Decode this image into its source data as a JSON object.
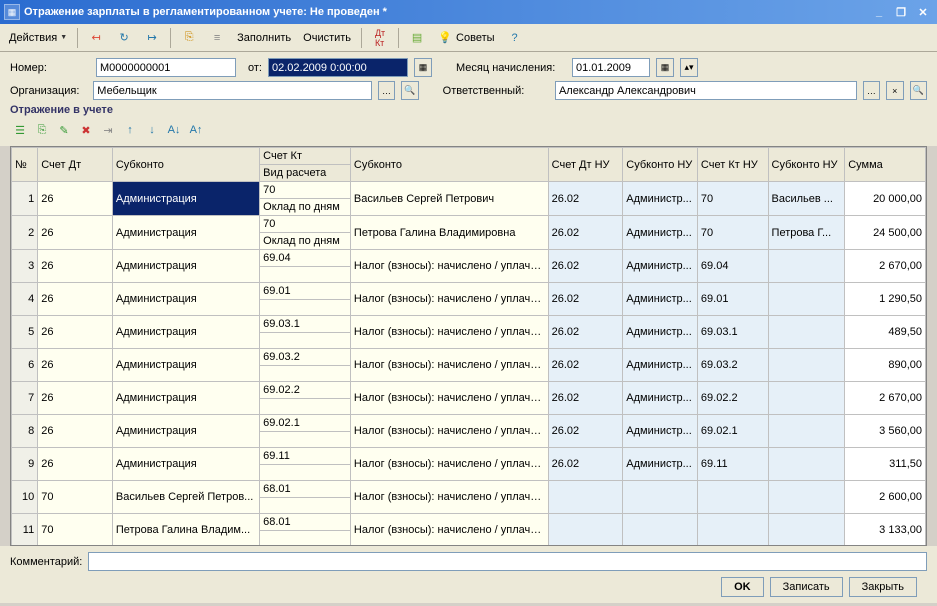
{
  "window": {
    "title": "Отражение зарплаты в регламентированном учете: Не проведен *"
  },
  "toolbar": {
    "actions": "Действия",
    "fill": "Заполнить",
    "clear": "Очистить",
    "advice": "Советы"
  },
  "form": {
    "number_lbl": "Номер:",
    "number": "М0000000001",
    "from_lbl": "от:",
    "from": "02.02.2009 0:00:00",
    "month_lbl": "Месяц начисления:",
    "month": "01.01.2009",
    "org_lbl": "Организация:",
    "org": "Мебельщик",
    "resp_lbl": "Ответственный:",
    "resp": "Александр Александрович"
  },
  "section": {
    "title": "Отражение в учете"
  },
  "grid": {
    "headers": {
      "n": "№",
      "dt": "Счет Дт",
      "sub": "Субконто",
      "kt": "Счет Кт",
      "vid": "Вид расчета",
      "sub2": "Субконто",
      "dtnu": "Счет Дт НУ",
      "subnu": "Субконто НУ",
      "ktnu": "Счет Кт НУ",
      "subnu2": "Субконто НУ",
      "sum": "Сумма"
    },
    "rows": [
      {
        "n": "1",
        "dt": "26",
        "sub": "Администрация",
        "kt": "70",
        "vid": "Оклад по дням",
        "sub2": "Васильев Сергей Петрович",
        "dtnu": "26.02",
        "subnu": "Администр...",
        "ktnu": "70",
        "subnu2": "Васильев ...",
        "sum": "20 000,00",
        "sel": true
      },
      {
        "n": "2",
        "dt": "26",
        "sub": "Администрация",
        "kt": "70",
        "vid": "Оклад по дням",
        "sub2": "Петрова Галина Владимировна",
        "dtnu": "26.02",
        "subnu": "Администр...",
        "ktnu": "70",
        "subnu2": "Петрова Г...",
        "sum": "24 500,00"
      },
      {
        "n": "3",
        "dt": "26",
        "sub": "Администрация",
        "kt": "69.04",
        "vid": "",
        "sub2": "Налог (взносы): начислено / уплачено",
        "dtnu": "26.02",
        "subnu": "Администр...",
        "ktnu": "69.04",
        "subnu2": "",
        "sum": "2 670,00"
      },
      {
        "n": "4",
        "dt": "26",
        "sub": "Администрация",
        "kt": "69.01",
        "vid": "",
        "sub2": "Налог (взносы): начислено / уплачено",
        "dtnu": "26.02",
        "subnu": "Администр...",
        "ktnu": "69.01",
        "subnu2": "",
        "sum": "1 290,50"
      },
      {
        "n": "5",
        "dt": "26",
        "sub": "Администрация",
        "kt": "69.03.1",
        "vid": "",
        "sub2": "Налог (взносы): начислено / уплачено",
        "dtnu": "26.02",
        "subnu": "Администр...",
        "ktnu": "69.03.1",
        "subnu2": "",
        "sum": "489,50"
      },
      {
        "n": "6",
        "dt": "26",
        "sub": "Администрация",
        "kt": "69.03.2",
        "vid": "",
        "sub2": "Налог (взносы): начислено / уплачено",
        "dtnu": "26.02",
        "subnu": "Администр...",
        "ktnu": "69.03.2",
        "subnu2": "",
        "sum": "890,00"
      },
      {
        "n": "7",
        "dt": "26",
        "sub": "Администрация",
        "kt": "69.02.2",
        "vid": "",
        "sub2": "Налог (взносы): начислено / уплачено",
        "dtnu": "26.02",
        "subnu": "Администр...",
        "ktnu": "69.02.2",
        "subnu2": "",
        "sum": "2 670,00"
      },
      {
        "n": "8",
        "dt": "26",
        "sub": "Администрация",
        "kt": "69.02.1",
        "vid": "",
        "sub2": "Налог (взносы): начислено / уплачено",
        "dtnu": "26.02",
        "subnu": "Администр...",
        "ktnu": "69.02.1",
        "subnu2": "",
        "sum": "3 560,00"
      },
      {
        "n": "9",
        "dt": "26",
        "sub": "Администрация",
        "kt": "69.11",
        "vid": "",
        "sub2": "Налог (взносы): начислено / уплачено",
        "dtnu": "26.02",
        "subnu": "Администр...",
        "ktnu": "69.11",
        "subnu2": "",
        "sum": "311,50"
      },
      {
        "n": "10",
        "dt": "70",
        "sub": "Васильев Сергей Петров...",
        "kt": "68.01",
        "vid": "",
        "sub2": "Налог (взносы): начислено / уплачено",
        "dtnu": "",
        "subnu": "",
        "ktnu": "",
        "subnu2": "",
        "sum": "2 600,00"
      },
      {
        "n": "11",
        "dt": "70",
        "sub": "Петрова Галина Владим...",
        "kt": "68.01",
        "vid": "",
        "sub2": "Налог (взносы): начислено / уплачено",
        "dtnu": "",
        "subnu": "",
        "ktnu": "",
        "subnu2": "",
        "sum": "3 133,00"
      }
    ]
  },
  "footer": {
    "comment_lbl": "Комментарий:"
  },
  "buttons": {
    "ok": "OK",
    "save": "Записать",
    "close": "Закрыть"
  }
}
